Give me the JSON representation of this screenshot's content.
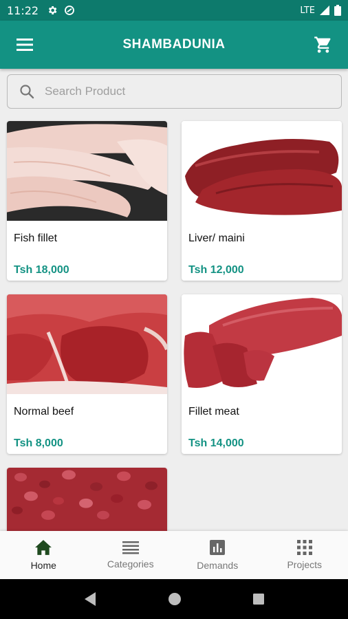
{
  "status_bar": {
    "time": "11:22",
    "network": "LTE"
  },
  "app_bar": {
    "title": "SHAMBADUNIA"
  },
  "search": {
    "placeholder": "Search Product"
  },
  "products": [
    {
      "name": "Fish fillet",
      "price": "Tsh 18,000"
    },
    {
      "name": "Liver/ maini",
      "price": "Tsh 12,000"
    },
    {
      "name": "Normal beef",
      "price": "Tsh 8,000"
    },
    {
      "name": "Fillet meat",
      "price": "Tsh 14,000"
    }
  ],
  "bottom_nav": [
    {
      "label": "Home",
      "icon": "home-icon",
      "active": true
    },
    {
      "label": "Categories",
      "icon": "list-icon"
    },
    {
      "label": "Demands",
      "icon": "bar-chart-icon"
    },
    {
      "label": "Projects",
      "icon": "grid-icon"
    }
  ],
  "colors": {
    "status": "#0d7a6c",
    "primary": "#139283",
    "price": "#139283"
  }
}
